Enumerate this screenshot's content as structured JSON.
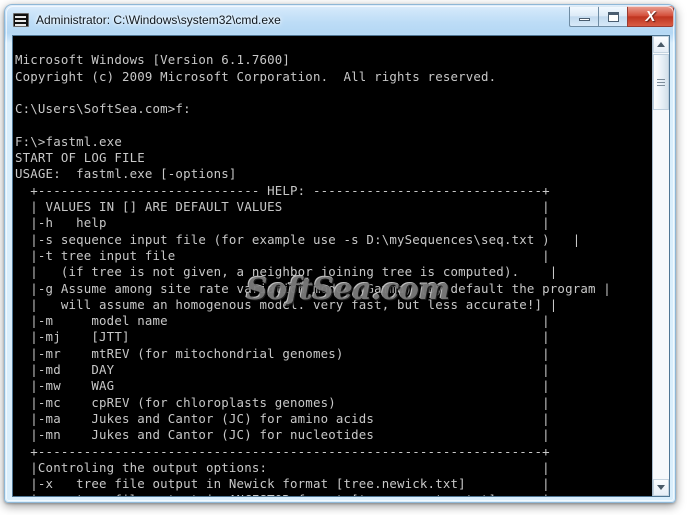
{
  "window": {
    "title": "Administrator: C:\\Windows\\system32\\cmd.exe",
    "icon": "cmd-console-icon",
    "controls": {
      "minimize_label": "–",
      "maximize_label": "□",
      "close_label": "X"
    },
    "frame_color": "#b5d8f4",
    "close_color": "#c4402c"
  },
  "console": {
    "background": "#000000",
    "foreground": "#c8c8c8",
    "watermark": "SoftSea.com",
    "text": "Microsoft Windows [Version 6.1.7600]\nCopyright (c) 2009 Microsoft Corporation.  All rights reserved.\n\nC:\\Users\\SoftSea.com>f:\n\nF:\\>fastml.exe\nSTART OF LOG FILE\nUSAGE:  fastml.exe [-options]\n  +----------------------------- HELP: ------------------------------+\n  | VALUES IN [] ARE DEFAULT VALUES                                  |\n  |-h   help                                                         |\n  |-s sequence input file (for example use -s D:\\mySequences\\seq.txt )   |\n  |-t tree input file                                                |\n  |   (if tree is not given, a neighbor joining tree is computed).    |\n  |-g Assume among site rate variation model (Gamma) [By default the program |\n  |   will assume an homogenous model. very fast, but less accurate!] |\n  |-m     model name                                                 |\n  |-mj    [JTT]                                                      |\n  |-mr    mtREV (for mitochondrial genomes)                          |\n  |-md    DAY                                                        |\n  |-mw    WAG                                                        |\n  |-mc    cpREV (for chloroplasts genomes)                           |\n  |-ma    Jukes and Cantor (JC) for amino acids                      |\n  |-mn    Jukes and Cantor (JC) for nucleotides                      |\n  +------------------------------------------------------------------+\n  |Controling the output options:                                    |\n  |-x   tree file output in Newick format [tree.newick.txt]          |\n  |-y   tree file output in ANCESTOR format [tree.ancestor.txt]      |\n  |-j   joint sequences output file [seq.joint.txt]                  |\n  |-k   marginal sequences output file [seq.marginal.txt]            |\n  |-d   joint probabilities output file [prob.joint.txt]             |\n  |-e   marginal probabilities output file [prob.marginal.txt]       |\n  |-q   ancestral sequences output format.  -qc = [CLUSTAL], -qf = FASTA |\n  |     -qm = MOLPHY, -qs = MASE, -qp = PHLIYP, -qn = Nexus          |\n  +------------------------------------------------------------------+\n  |Advances options:                                                 |\n  |-a   Treshold for computing again marginal probabilities [0.9]    |\n  |-b   Do not optimize branch lengths on starting tree              |"
  },
  "scrollbar": {
    "up_arrow": "scroll-up-arrow",
    "down_arrow": "scroll-down-arrow",
    "thumb": "scroll-thumb"
  }
}
